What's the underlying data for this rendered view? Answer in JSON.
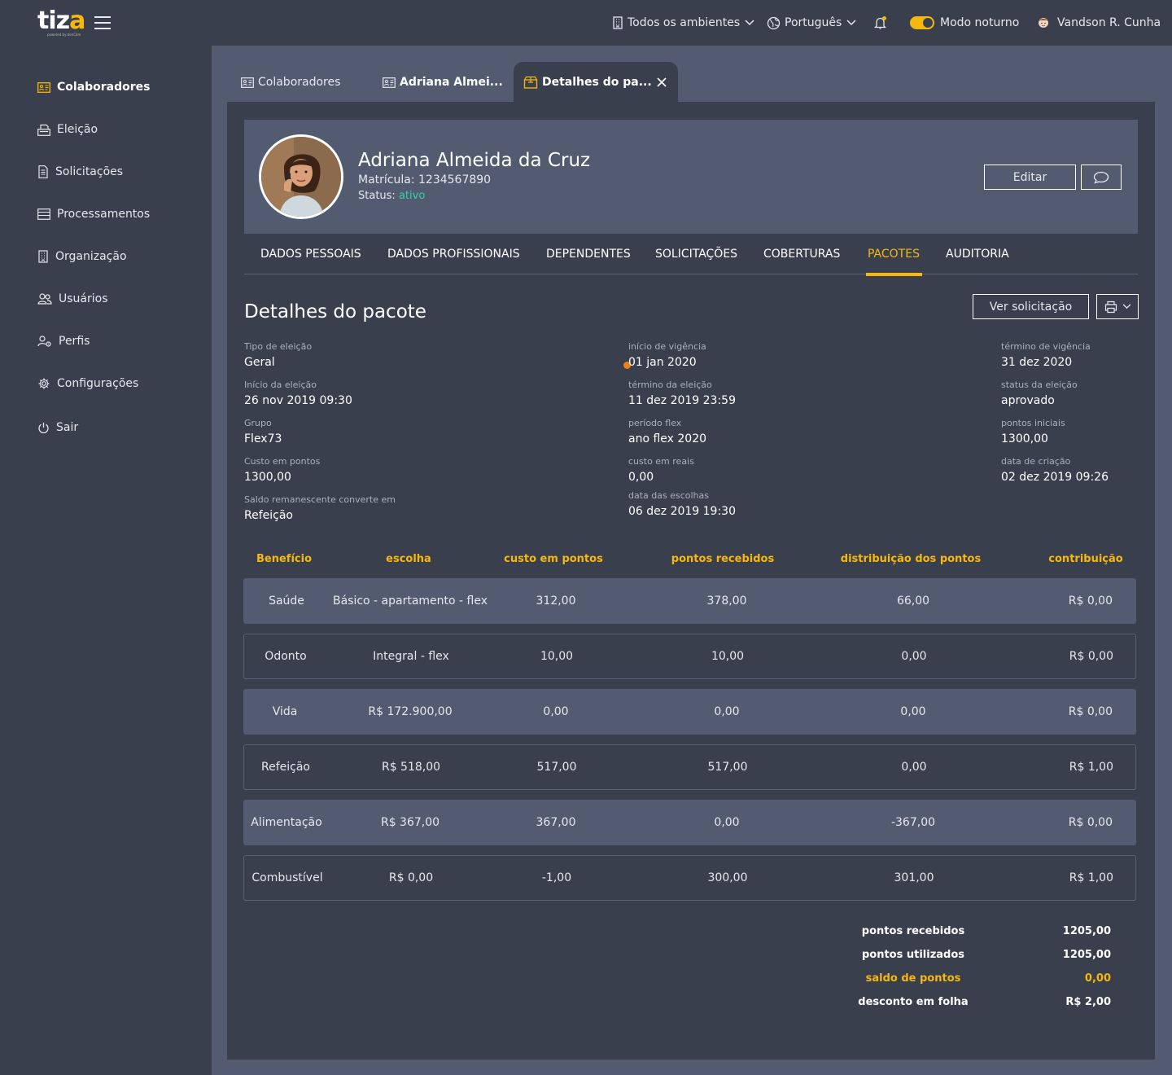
{
  "app": {
    "logo": "tiz",
    "logo_accent": "a",
    "logo_sub": "powered by benCâm"
  },
  "topbar": {
    "environment": "Todos os ambientes",
    "language": "Português",
    "dark_mode": "Modo noturno",
    "user": "Vandson R. Cunha"
  },
  "sidebar": {
    "items": [
      {
        "label": "Colaboradores",
        "icon": "id-card-icon",
        "active": true
      },
      {
        "label": "Eleição",
        "icon": "ballot-box-icon"
      },
      {
        "label": "Solicitações",
        "icon": "document-icon"
      },
      {
        "label": "Processamentos",
        "icon": "list-icon"
      },
      {
        "label": "Organização",
        "icon": "building-icon"
      },
      {
        "label": "Usuários",
        "icon": "users-icon"
      },
      {
        "label": "Perfis",
        "icon": "profile-gear-icon"
      },
      {
        "label": "Configurações",
        "icon": "gear-icon"
      },
      {
        "label": "Sair",
        "icon": "power-icon"
      }
    ]
  },
  "tabs": [
    {
      "label": "Colaboradores"
    },
    {
      "label": "Adriana Almei..."
    },
    {
      "label": "Detalhes do pa..."
    }
  ],
  "profile": {
    "name": "Adriana Almeida da Cruz",
    "matricula": "Matrícula: 1234567890",
    "status_label": "Status:",
    "status_value": "ativo",
    "edit_label": "Editar"
  },
  "subnav": [
    "DADOS PESSOAIS",
    "DADOS PROFISSIONAIS",
    "DEPENDENTES",
    "SOLICITAÇÕES",
    "COBERTURAS",
    "PACOTES",
    "AUDITORIA"
  ],
  "section": {
    "title": "Detalhes do pacote",
    "ver_solicitacao": "Ver solicitação"
  },
  "fields": {
    "col1": [
      {
        "label": "Tipo de eleição",
        "value": "Geral"
      },
      {
        "label": "Início da eleição",
        "value": "26 nov 2019 09:30"
      },
      {
        "label": "Grupo",
        "value": "Flex73"
      },
      {
        "label": "Custo em pontos",
        "value": "1300,00"
      },
      {
        "label": "Saldo remanescente converte em",
        "value": "Refeição"
      }
    ],
    "col2": [
      {
        "label": "início de vigência",
        "value": "01 jan 2020"
      },
      {
        "label": "término da eleição",
        "value": "11 dez 2019 23:59"
      },
      {
        "label": "período flex",
        "value": "ano flex 2020"
      },
      {
        "label": "custo em reais",
        "value": "0,00"
      },
      {
        "label": "data das escolhas",
        "value": "06 dez 2019 19:30"
      }
    ],
    "col3": [
      {
        "label": "término de vigência",
        "value": "31 dez 2020"
      },
      {
        "label": "status da eleição",
        "value": "aprovado"
      },
      {
        "label": "pontos iniciais",
        "value": "1300,00"
      },
      {
        "label": "data de criação",
        "value": "02 dez 2019 09:26"
      }
    ]
  },
  "table": {
    "headers": [
      "Benefício",
      "escolha",
      "custo em pontos",
      "pontos recebidos",
      "distribuição dos pontos",
      "contribuição"
    ],
    "rows": [
      [
        "Saúde",
        "Básico - apartamento - flex",
        "312,00",
        "378,00",
        "66,00",
        "R$ 0,00"
      ],
      [
        "Odonto",
        "Integral - flex",
        "10,00",
        "10,00",
        "0,00",
        "R$ 0,00"
      ],
      [
        "Vida",
        "R$ 172.900,00",
        "0,00",
        "0,00",
        "0,00",
        "R$ 0,00"
      ],
      [
        "Refeição",
        "R$ 518,00",
        "517,00",
        "517,00",
        "0,00",
        "R$ 1,00"
      ],
      [
        "Alimentação",
        "R$ 367,00",
        "367,00",
        "0,00",
        "-367,00",
        "R$ 0,00"
      ],
      [
        "Combustível",
        "R$ 0,00",
        "-1,00",
        "300,00",
        "301,00",
        "R$ 1,00"
      ]
    ]
  },
  "summary": [
    {
      "label": "pontos recebidos",
      "value": "1205,00"
    },
    {
      "label": "pontos utilizados",
      "value": "1205,00"
    },
    {
      "label": "saldo de pontos",
      "value": "0,00",
      "highlight": true
    },
    {
      "label": "desconto em folha",
      "value": "R$ 2,00"
    }
  ],
  "colors": {
    "accent": "#f5b80f",
    "status_ok": "#33d3a6",
    "badge": "#f07f1a",
    "panel": "#525b6f",
    "background": "#3a3f4d"
  }
}
